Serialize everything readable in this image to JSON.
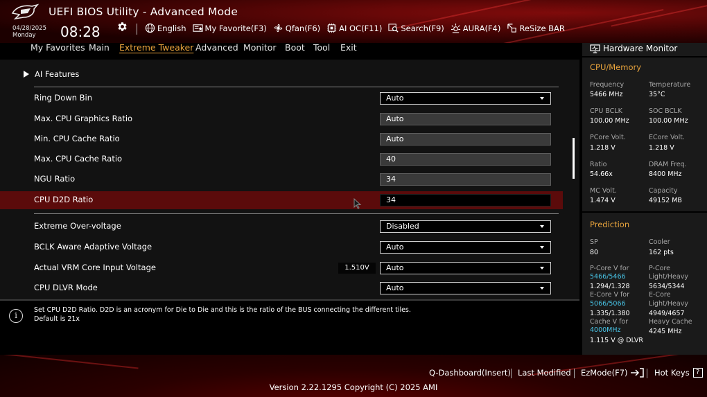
{
  "header": {
    "title": "UEFI BIOS Utility - Advanced Mode",
    "date": "04/28/2025",
    "day": "Monday",
    "time": "08:28",
    "toolbar": [
      {
        "icon": "globe-icon",
        "label": "English"
      },
      {
        "icon": "my-favorite-icon",
        "label": "My Favorite(F3)"
      },
      {
        "icon": "fan-icon",
        "label": "Qfan(F6)"
      },
      {
        "icon": "ai-oc-icon",
        "label": "AI OC(F11)"
      },
      {
        "icon": "search-icon",
        "label": "Search(F9)"
      },
      {
        "icon": "aura-icon",
        "label": "AURA(F4)"
      },
      {
        "icon": "resize-bar-icon",
        "label": "ReSize BAR"
      }
    ]
  },
  "nav": {
    "items": [
      "My Favorites",
      "Main",
      "Extreme Tweaker",
      "Advanced",
      "Monitor",
      "Boot",
      "Tool",
      "Exit"
    ],
    "active": "Extreme Tweaker"
  },
  "content": {
    "section": "AI Features",
    "rows": [
      {
        "label": "Ring Down Bin",
        "value": "Auto",
        "type": "select"
      },
      {
        "label": "Max. CPU Graphics Ratio",
        "value": "Auto",
        "type": "field"
      },
      {
        "label": "Min. CPU Cache Ratio",
        "value": "Auto",
        "type": "field"
      },
      {
        "label": "Max. CPU Cache Ratio",
        "value": "40",
        "type": "field"
      },
      {
        "label": "NGU Ratio",
        "value": "34",
        "type": "field"
      },
      {
        "label": "CPU D2D Ratio",
        "value": "34",
        "type": "field",
        "selected": true
      },
      {
        "label": "Extreme Over-voltage",
        "value": "Disabled",
        "type": "select"
      },
      {
        "label": "BCLK Aware Adaptive Voltage",
        "value": "Auto",
        "type": "select"
      },
      {
        "label": "Actual VRM Core Input Voltage",
        "value": "Auto",
        "type": "select",
        "reading": "1.510V"
      },
      {
        "label": "CPU DLVR Mode",
        "value": "Auto",
        "type": "select"
      }
    ],
    "help_line1": "Set CPU D2D Ratio. D2D is an acronym for Die to Die and this is the ratio of the BUS connecting the different tiles.",
    "help_line2": "Default is 21x"
  },
  "hw_monitor": {
    "title": "Hardware Monitor",
    "cpu_memory": {
      "heading": "CPU/Memory",
      "items": [
        {
          "label": "Frequency",
          "value": "5466 MHz"
        },
        {
          "label": "Temperature",
          "value": "35°C"
        },
        {
          "label": "CPU BCLK",
          "value": "100.00 MHz"
        },
        {
          "label": "SOC BCLK",
          "value": "100.00 MHz"
        },
        {
          "label": "PCore Volt.",
          "value": "1.218 V"
        },
        {
          "label": "ECore Volt.",
          "value": "1.218 V"
        },
        {
          "label": "Ratio",
          "value": "54.66x"
        },
        {
          "label": "DRAM Freq.",
          "value": "8400 MHz"
        },
        {
          "label": "MC Volt.",
          "value": "1.474 V"
        },
        {
          "label": "Capacity",
          "value": "49152 MB"
        }
      ]
    },
    "prediction": {
      "heading": "Prediction",
      "sp_label": "SP",
      "sp_value": "80",
      "cooler_label": "Cooler",
      "cooler_value": "162 pts",
      "pcore_v_label": "P-Core V for",
      "pcore_v_freq": "5466/5466",
      "pcore_v_value": "1.294/1.328",
      "pcore_lh_label1": "P-Core",
      "pcore_lh_label2": "Light/Heavy",
      "pcore_lh_value": "5634/5344",
      "ecore_v_label": "E-Core V for",
      "ecore_v_freq": "5066/5066",
      "ecore_v_value": "1.335/1.380",
      "ecore_lh_label1": "E-Core",
      "ecore_lh_label2": "Light/Heavy",
      "ecore_lh_value": "4949/4657",
      "cache_v_label": "Cache V for",
      "cache_v_freq": "4000MHz",
      "cache_v_value": "1.115 V @ DLVR",
      "heavy_cache_label": "Heavy Cache",
      "heavy_cache_value": "4245 MHz"
    }
  },
  "footer": {
    "q_dashboard": "Q-Dashboard(Insert)",
    "last_modified": "Last Modified",
    "ezmode": "EzMode(F7)",
    "hot_keys": "Hot Keys",
    "hot_keys_glyph": "?",
    "version": "Version 2.22.1295 Copyright (C) 2025 AMI"
  }
}
